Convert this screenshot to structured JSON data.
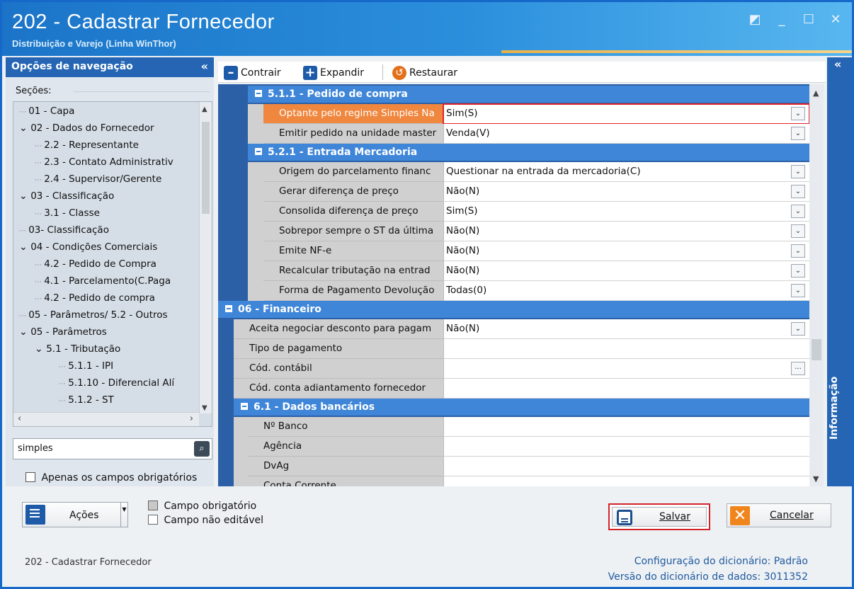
{
  "window": {
    "title": "202 - Cadastrar  Fornecedor",
    "subtitle": "Distribuição e Varejo (Linha WinThor)",
    "controls": [
      "restore-down",
      "minimize",
      "maximize",
      "close"
    ]
  },
  "nav": {
    "header": "Opções de navegação",
    "collapse": "«",
    "sections_label": "Seções:",
    "tree": [
      {
        "label": "01 - Capa",
        "level": 0,
        "expander": ""
      },
      {
        "label": "02 - Dados do Fornecedor",
        "level": 0,
        "expander": "v"
      },
      {
        "label": "2.2 - Representante",
        "level": 1,
        "expander": ""
      },
      {
        "label": "2.3 - Contato Administrativ",
        "level": 1,
        "expander": ""
      },
      {
        "label": "2.4 - Supervisor/Gerente",
        "level": 1,
        "expander": ""
      },
      {
        "label": "03 - Classificação",
        "level": 0,
        "expander": "v"
      },
      {
        "label": "3.1 - Classe",
        "level": 1,
        "expander": ""
      },
      {
        "label": "03- Classificação",
        "level": 0,
        "expander": ""
      },
      {
        "label": "04 - Condições Comerciais",
        "level": 0,
        "expander": "v"
      },
      {
        "label": "4.2 - Pedido de Compra",
        "level": 1,
        "expander": ""
      },
      {
        "label": "4.1 - Parcelamento(C.Paga",
        "level": 1,
        "expander": ""
      },
      {
        "label": "4.2 - Pedido de compra",
        "level": 1,
        "expander": ""
      },
      {
        "label": "05 - Parâmetros/ 5.2 - Outros",
        "level": 0,
        "expander": ""
      },
      {
        "label": "05 - Parâmetros",
        "level": 0,
        "expander": "v"
      },
      {
        "label": "5.1 - Tributação",
        "level": 1,
        "expander": "v"
      },
      {
        "label": "5.1.1 - IPI",
        "level": 2,
        "expander": ""
      },
      {
        "label": "5.1.10 - Diferencial Alí",
        "level": 2,
        "expander": ""
      },
      {
        "label": "5.1.2 - ST",
        "level": 2,
        "expander": ""
      }
    ],
    "search_value": "simples",
    "only_required_label": "Apenas os campos obrigatórios"
  },
  "toolbar": {
    "contract": "Contrair",
    "expand": "Expandir",
    "restore": "Restaurar"
  },
  "grid": {
    "sections": [
      {
        "id": "s511",
        "title": "5.1.1 - Pedido de compra"
      },
      {
        "id": "s521",
        "title": "5.2.1 - Entrada Mercadoria"
      },
      {
        "id": "s06",
        "title": "06 - Financeiro"
      },
      {
        "id": "s61",
        "title": "6.1 - Dados bancários"
      }
    ],
    "rows_511": [
      {
        "label": "Optante pelo regime Simples Na",
        "value": "Sim(S)",
        "control": "dropdown",
        "highlighted": true
      },
      {
        "label": "Emitir pedido na unidade master",
        "value": "Venda(V)",
        "control": "dropdown"
      }
    ],
    "rows_521": [
      {
        "label": "Origem do parcelamento financ",
        "value": "Questionar na entrada da mercadoria(C)",
        "control": "dropdown"
      },
      {
        "label": "Gerar diferença de preço",
        "value": "Não(N)",
        "control": "dropdown"
      },
      {
        "label": "Consolida diferença de preço",
        "value": "Sim(S)",
        "control": "dropdown"
      },
      {
        "label": "Sobrepor sempre o ST da última",
        "value": "Não(N)",
        "control": "dropdown"
      },
      {
        "label": "Emite NF-e",
        "value": "Não(N)",
        "control": "dropdown"
      },
      {
        "label": "Recalcular tributação na entrad",
        "value": "Não(N)",
        "control": "dropdown"
      },
      {
        "label": "Forma de Pagamento Devolução",
        "value": "Todas(0)",
        "control": "dropdown"
      }
    ],
    "rows_06": [
      {
        "label": "Aceita negociar desconto para pagam",
        "value": "Não(N)",
        "control": "dropdown"
      },
      {
        "label": "Tipo de pagamento",
        "value": "",
        "control": "text"
      },
      {
        "label": "Cód. contábil",
        "value": "",
        "control": "ellipsis"
      },
      {
        "label": "Cód. conta adiantamento fornecedor",
        "value": "",
        "control": "text"
      }
    ],
    "rows_61": [
      {
        "label": "Nº Banco",
        "value": "",
        "control": "text"
      },
      {
        "label": "Agência",
        "value": "",
        "control": "text"
      },
      {
        "label": "DvAg",
        "value": "",
        "control": "text"
      },
      {
        "label": "Conta Corrente",
        "value": "",
        "control": "text"
      }
    ]
  },
  "info_panel": {
    "label": "Informação",
    "chevron": "«"
  },
  "bottom": {
    "actions_label": "Ações",
    "legend_required": "Campo obrigatório",
    "legend_not_editable": "Campo não editável",
    "save_label": "Salvar",
    "cancel_label": "Cancelar",
    "status_left": "202 - Cadastrar  Fornecedor",
    "dict_config_label": "Configuração do dicionário: ",
    "dict_config_value": "Padrão",
    "dict_version_label": "Versão do dicionário de dados: ",
    "dict_version_value": "3011352"
  },
  "colors": {
    "title_bar": "#2b8fdc",
    "nav_header": "#2565b3",
    "section_header": "#3f86d9",
    "highlight_border": "#e0242a",
    "highlight_label": "#f0873f"
  }
}
